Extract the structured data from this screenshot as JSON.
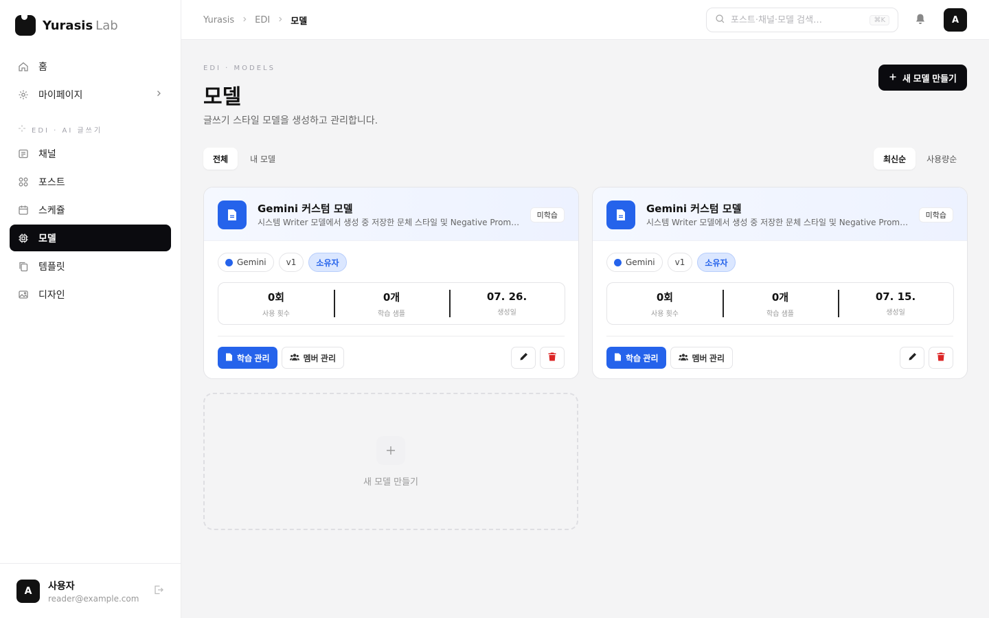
{
  "brand": {
    "name": "Yurasis",
    "sub": "Lab"
  },
  "nav": {
    "top": [
      {
        "label": "홈",
        "icon": "home-icon"
      },
      {
        "label": "마이페이지",
        "icon": "gear-icon"
      }
    ],
    "section_label": "EDI · AI 글쓰기",
    "items": [
      {
        "label": "채널",
        "icon": "channel-icon"
      },
      {
        "label": "포스트",
        "icon": "grid-icon"
      },
      {
        "label": "스케쥴",
        "icon": "calendar-icon"
      },
      {
        "label": "모델",
        "icon": "cpu-icon"
      },
      {
        "label": "템플릿",
        "icon": "copy-icon"
      },
      {
        "label": "디자인",
        "icon": "image-icon"
      }
    ]
  },
  "user": {
    "initial": "A",
    "name": "사용자",
    "email": "reader@example.com"
  },
  "header": {
    "breadcrumbs": [
      "Yurasis",
      "EDI",
      "모델"
    ],
    "search_placeholder": "포스트·채널·모델 검색…",
    "search_shortcut": "⌘K",
    "avatar_initial": "A"
  },
  "page": {
    "eyebrow": "EDI · MODELS",
    "title": "모델",
    "description": "글쓰기 스타일 모델을 생성하고 관리합니다.",
    "new_button": "새 모델 만들기"
  },
  "filters": {
    "tabs": [
      "전체",
      "내 모델"
    ],
    "sorts": [
      "최신순",
      "사용량순"
    ]
  },
  "cards": [
    {
      "title": "Gemini 커스텀 모델",
      "description": "시스템 Writer 모델에서 생성 중 저장한 문체 스타일 및 Negative Prompt 설정",
      "status": "미학습",
      "provider": "Gemini",
      "version": "v1",
      "role": "소유자",
      "stats": [
        {
          "value": "0회",
          "label": "사용 횟수"
        },
        {
          "value": "0개",
          "label": "학습 샘플"
        },
        {
          "value": "07. 26.",
          "label": "생성일"
        }
      ],
      "train_button": "학습 관리",
      "member_button": "멤버 관리"
    },
    {
      "title": "Gemini 커스텀 모델",
      "description": "시스템 Writer 모델에서 생성 중 저장한 문체 스타일 및 Negative Prompt 설정",
      "status": "미학습",
      "provider": "Gemini",
      "version": "v1",
      "role": "소유자",
      "stats": [
        {
          "value": "0회",
          "label": "사용 횟수"
        },
        {
          "value": "0개",
          "label": "학습 샘플"
        },
        {
          "value": "07. 15.",
          "label": "생성일"
        }
      ],
      "train_button": "학습 관리",
      "member_button": "멤버 관리"
    }
  ],
  "empty_card": {
    "label": "새 모델 만들기"
  },
  "colors": {
    "accent": "#2563eb",
    "dark": "#0b0b0f",
    "danger": "#dc2626"
  }
}
